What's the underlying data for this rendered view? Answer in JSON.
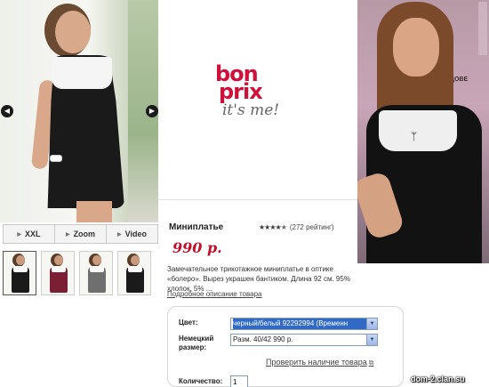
{
  "gallery": {
    "nav_prev": "◀",
    "nav_next": "▶",
    "tools": [
      {
        "label": "XXL",
        "icon": "triangle-right-icon"
      },
      {
        "label": "Zoom",
        "icon": "triangle-right-icon"
      },
      {
        "label": "Video",
        "icon": "triangle-right-icon"
      }
    ],
    "thumbnails": [
      {
        "dress_color": "#1a1a1a"
      },
      {
        "dress_color": "#7a1f34"
      },
      {
        "dress_color": "#6f6f6f"
      },
      {
        "dress_color": "#1a1a1a"
      }
    ]
  },
  "logo": {
    "bon": "bon",
    "prix": "prix",
    "slogan": "it's me!",
    "brand_color": "#d0103a"
  },
  "right_photo": {
    "background_text": "ДОВЕ"
  },
  "product": {
    "name": "Миниплатье",
    "stars_filled": 4,
    "stars_total": 5,
    "rating_text": "(272 рейтинг)",
    "price": "990 р.",
    "price_color": "#c0102a",
    "description": "Замечательное трикотажное миниплатье в оптике «болеро». Вырез украшен бантиком. Длина 92 см. 95% хлопок, 5% ...",
    "details_link": "Подробное описание товара"
  },
  "options": {
    "color_label": "Цвет:",
    "color_value": "черный/белый 92292994 (Временн",
    "size_label": "Немецкий размер:",
    "size_value": "Разм. 40/42 990 р.",
    "check_link": "Проверить наличие товара",
    "qty_label": "Количество:",
    "qty_value": "1"
  },
  "watermark": "dom-2.clan.su"
}
